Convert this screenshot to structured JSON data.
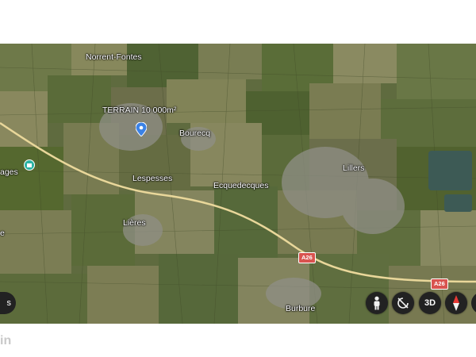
{
  "map": {
    "places": {
      "norrent_fontes": "Norrent-Fontes",
      "terrain": "TERRAIN 10 000m²",
      "bourecq": "Bourecq",
      "lespesses": "Lespesses",
      "ecquedecques": "Ecquedecques",
      "lillers": "Lillers",
      "lieres": "Lières",
      "burbure": "Burbure",
      "left_label_1": "ages",
      "left_label_2": "e"
    },
    "road_shields": [
      "A26",
      "A26"
    ],
    "road_color": "#e9d79a",
    "shield_color": "#d9534f",
    "pin_color": "#3b82e6",
    "poi_color": "#2bb3a3"
  },
  "controls": {
    "left_edge_label": "s",
    "street_view_icon": "pegman-icon",
    "rotate_icon": "rotate-icon",
    "view_3d_label": "3D",
    "compass_icon": "compass-icon"
  },
  "watermark": "in"
}
